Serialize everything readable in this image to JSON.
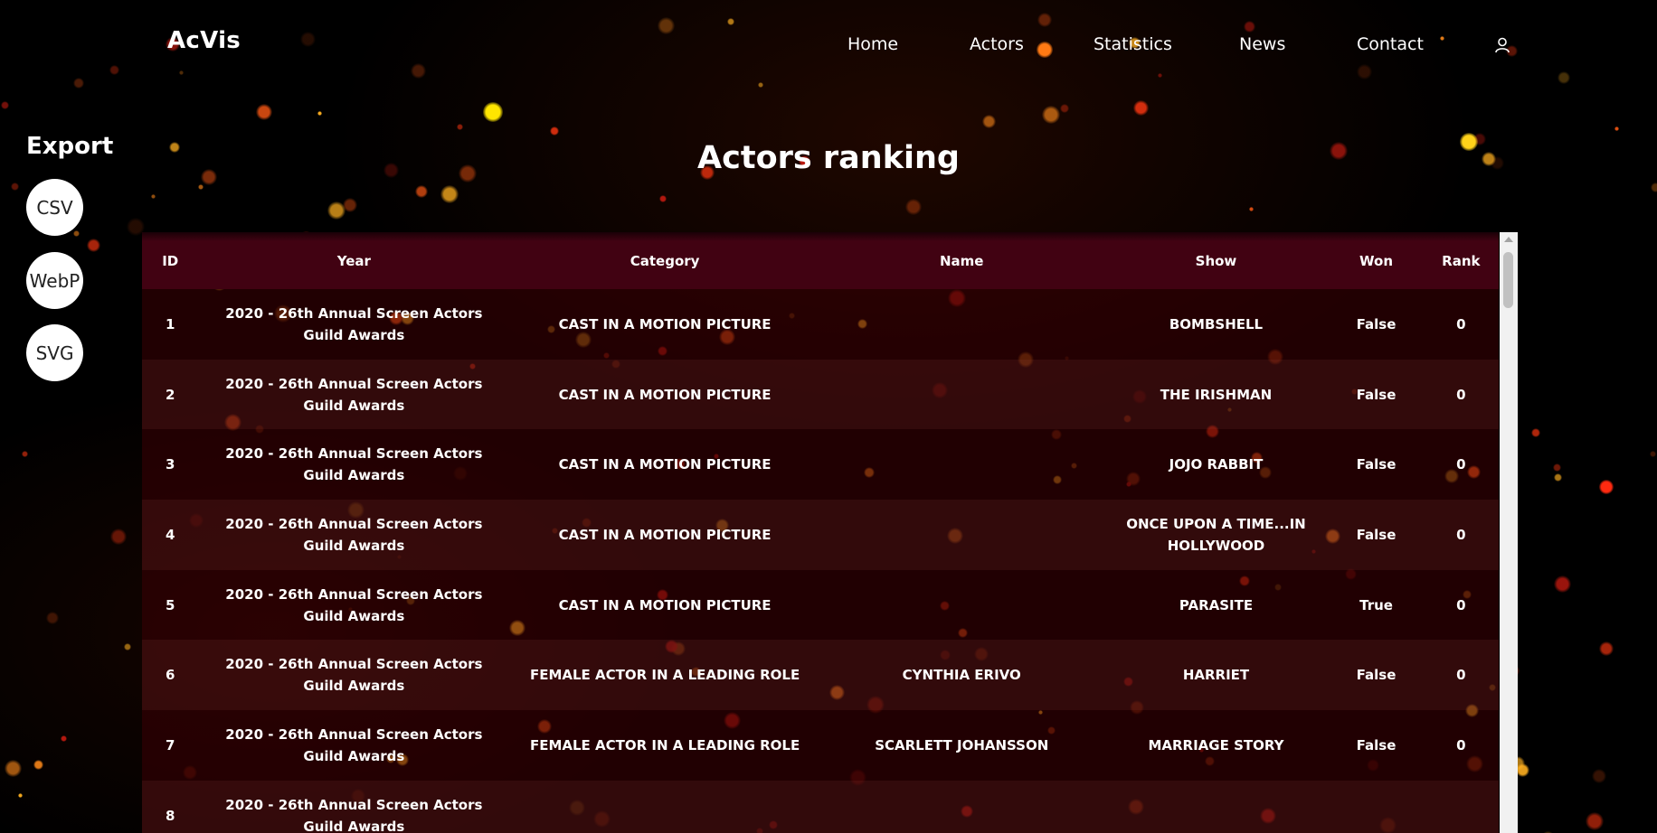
{
  "header": {
    "brand": "AcVis",
    "nav": [
      "Home",
      "Actors",
      "Statistics",
      "News",
      "Contact"
    ]
  },
  "sidebar": {
    "title": "Export",
    "buttons": [
      "CSV",
      "WebP",
      "SVG"
    ]
  },
  "main": {
    "title": "Actors ranking"
  },
  "table": {
    "columns": [
      "ID",
      "Year",
      "Category",
      "Name",
      "Show",
      "Won",
      "Rank"
    ],
    "rows": [
      [
        "1",
        "2020 - 26th Annual Screen Actors Guild Awards",
        "CAST IN A MOTION PICTURE",
        "",
        "BOMBSHELL",
        "False",
        "0"
      ],
      [
        "2",
        "2020 - 26th Annual Screen Actors Guild Awards",
        "CAST IN A MOTION PICTURE",
        "",
        "THE IRISHMAN",
        "False",
        "0"
      ],
      [
        "3",
        "2020 - 26th Annual Screen Actors Guild Awards",
        "CAST IN A MOTION PICTURE",
        "",
        "JOJO RABBIT",
        "False",
        "0"
      ],
      [
        "4",
        "2020 - 26th Annual Screen Actors Guild Awards",
        "CAST IN A MOTION PICTURE",
        "",
        "ONCE UPON A TIME...IN HOLLYWOOD",
        "False",
        "0"
      ],
      [
        "5",
        "2020 - 26th Annual Screen Actors Guild Awards",
        "CAST IN A MOTION PICTURE",
        "",
        "PARASITE",
        "True",
        "0"
      ],
      [
        "6",
        "2020 - 26th Annual Screen Actors Guild Awards",
        "FEMALE ACTOR IN A LEADING ROLE",
        "CYNTHIA ERIVO",
        "HARRIET",
        "False",
        "0"
      ],
      [
        "7",
        "2020 - 26th Annual Screen Actors Guild Awards",
        "FEMALE ACTOR IN A LEADING ROLE",
        "SCARLETT JOHANSSON",
        "MARRIAGE STORY",
        "False",
        "0"
      ],
      [
        "8",
        "2020 - 26th Annual Screen Actors Guild Awards",
        "",
        "",
        "",
        "",
        ""
      ]
    ]
  },
  "colors": {
    "header_row": "#410212",
    "row_dark": "#3c0004",
    "row_light": "#501012",
    "accent": "#ff8a1a"
  },
  "icons": {
    "user": "user-icon"
  }
}
